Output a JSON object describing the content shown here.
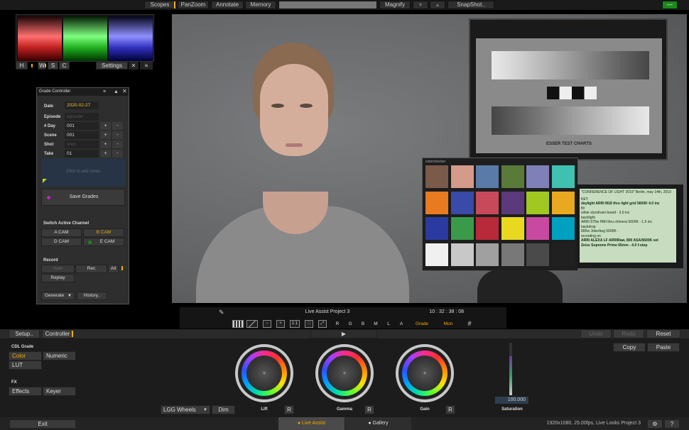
{
  "topbar": {
    "scopes": "Scopes",
    "panzoom": "PanZoom",
    "annotate": "Annotate",
    "memory": "Memory",
    "magnify": "Magnify",
    "snapshot": "SnapShot..",
    "arrow_down": "▾",
    "arrow_up": "▴",
    "minimize": "—"
  },
  "scopes": {
    "buttons": [
      "H",
      "W",
      "S",
      "C"
    ],
    "settings": "Settings",
    "close": "✕",
    "menu": "≡"
  },
  "grade_controller": {
    "title": "Grade Controller",
    "date_label": "Date",
    "date_value": "2020-02-27",
    "episode_label": "Episode",
    "episode_placeholder": "episode",
    "day_label": "# Day",
    "day_value": "001",
    "scene_label": "Scene",
    "scene_value": "001",
    "shot_label": "Shot",
    "shot_placeholder": "shot",
    "take_label": "Take",
    "take_value": "01",
    "plus": "+",
    "minus": "-",
    "notes_placeholder": "Click to add notes",
    "save_grades": "Save Grades",
    "switch_channel": "Switch Active Channel",
    "a_cam": "A CAM",
    "b_cam": "B CAM",
    "d_cam": "D CAM",
    "e_cam": "E CAM",
    "record": "Record",
    "auto": "Auto",
    "rec": "Rec",
    "all": "All",
    "replay": "Replay",
    "generate": "Generate",
    "history": "History.."
  },
  "viewer": {
    "chart_title": "ESSER TEST CHARTS",
    "colorchecker": "colorchecker",
    "slate_title": "\"CONFERENCE OF LIGHT 2019\" Berlin, may 14th, 2019",
    "slate_key": "KEY",
    "slate_l1": "daylight ARRI M18 thru light grid 5600K 4.0 inc",
    "slate_l2": "fill",
    "slate_l3": "white styrofoam board - 3.0 inc",
    "slate_l4": "backlight",
    "slate_l5": "ARRI 575w HMI thru chimera 5600K - 1.5 inc",
    "slate_l6": "backdrop",
    "slate_l7": "800w Jokerbug 5600K -",
    "slate_l8": "recording on",
    "slate_l9": "ARRI ALEXA LF ARRIRaw, 800 ASA/5600K set",
    "slate_l10": "Zeiss Supreme Prime 65mm - 4.0 f-stop",
    "colors": [
      "#7a5a4a",
      "#d49a8a",
      "#5a7aa8",
      "#5a7a3a",
      "#8080b8",
      "#40c0b0",
      "#e87a20",
      "#3a4aa8",
      "#c84a5a",
      "#5a3a7a",
      "#a0c820",
      "#e8a820",
      "#2a3aa0",
      "#3a9a4a",
      "#b82a3a",
      "#e8d820",
      "#c84aa0",
      "#00a0c0",
      "#f0f0f0",
      "#c8c8c8",
      "#a0a0a0",
      "#787878",
      "#4a4a4a",
      "#202020"
    ]
  },
  "ctrlbar": {
    "pen": "✎",
    "project": "Live Assist Project 3",
    "timecode": "10 : 32 : 38 : 08",
    "one_to_one": "1:1",
    "r": "R",
    "g": "G",
    "b": "B",
    "m": "M",
    "l": "L",
    "a": "A",
    "grade": "Grade",
    "mon": "Mon",
    "grid": "#"
  },
  "lower": {
    "setup": "Setup..",
    "controller": "Controller",
    "play": "▶",
    "undo": "Undo",
    "redo": "Redo",
    "reset": "Reset",
    "copy": "Copy",
    "paste": "Paste",
    "cdl_grade": "CDL Grade",
    "color": "Color",
    "numeric": "Numeric",
    "lut": "LUT",
    "fx": "FX",
    "effects": "Effects",
    "keyer": "Keyer",
    "lgg_wheels": "LGG Wheels",
    "dim": "Dim",
    "lift": "Lift",
    "gamma": "Gamma",
    "gain": "Gain",
    "r_btn": "R",
    "saturation_value": "100.000",
    "saturation": "Saturation",
    "saturation_level": 0.74
  },
  "bottom": {
    "exit": "Exit",
    "live_assist": "Live Assist",
    "gallery": "Gallery",
    "status": "1920x1080, 25.00fps, Live Looks Project 3",
    "help": "?"
  }
}
